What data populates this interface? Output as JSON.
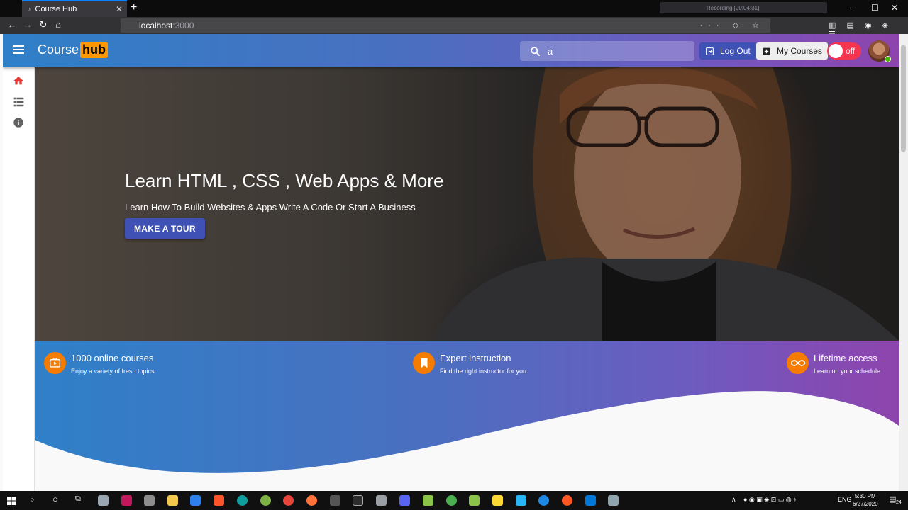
{
  "browser": {
    "tab_title": "Course Hub",
    "tab_close": "✕",
    "new_tab": "+",
    "recording": "Recording [00:04:31]",
    "url_host": "localhost",
    "url_port": ":3000",
    "url_actions": "··· ◇ ☆"
  },
  "appbar": {
    "logo_course": "Course",
    "logo_hub": "hub",
    "search_value": "a",
    "logout_label": "Log Out",
    "my_courses_label": "My Courses",
    "toggle_label": "off"
  },
  "hero": {
    "title": "Learn HTML , CSS , Web Apps & More",
    "subtitle": "Learn How To Build Websites & Apps Write A Code Or Start A Business",
    "cta_label": "MAKE A TOUR"
  },
  "features": [
    {
      "title": "1000 online courses",
      "desc": "Enjoy a variety of fresh topics",
      "icon": "tv-play-icon"
    },
    {
      "title": "Expert instruction",
      "desc": "Find the right instructor for you",
      "icon": "bookmark-icon"
    },
    {
      "title": "Lifetime access",
      "desc": "Learn on your schedule",
      "icon": "infinity-icon"
    }
  ],
  "taskbar": {
    "lang": "ENG",
    "time": "5:30 PM",
    "date": "6/27/2020",
    "notifications": "24"
  },
  "colors": {
    "gradient_start": "#2f80c8",
    "gradient_end": "#8e44ad",
    "primary": "#3f51b5",
    "accent": "#ff9800",
    "toggle": "#f5354f",
    "home_active": "#e53935"
  }
}
